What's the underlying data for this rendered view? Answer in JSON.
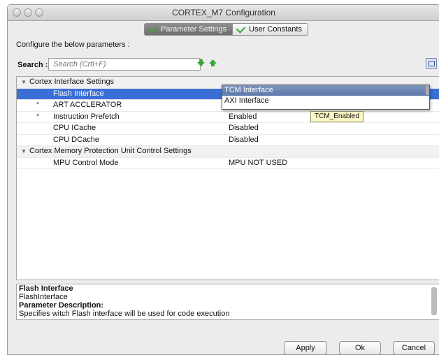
{
  "window": {
    "title": "CORTEX_M7 Configuration"
  },
  "tabs": [
    {
      "label": "Parameter Settings",
      "active": true
    },
    {
      "label": "User Constants",
      "active": false
    }
  ],
  "header": {
    "configure_text": "Configure the below parameters :"
  },
  "search": {
    "label": "Search :",
    "placeholder": "Search (Crtl+F)"
  },
  "tree": {
    "rows": [
      {
        "type": "group",
        "name": "Cortex Interface Settings",
        "value": ""
      },
      {
        "type": "param",
        "star": "",
        "name": "Flash Interface",
        "value": "",
        "selected": true
      },
      {
        "type": "param",
        "star": "*",
        "name": "ART ACCLERATOR",
        "value": ""
      },
      {
        "type": "param",
        "star": "*",
        "name": "Instruction Prefetch",
        "value": "Enabled"
      },
      {
        "type": "param",
        "star": "",
        "name": "CPU ICache",
        "value": "Disabled"
      },
      {
        "type": "param",
        "star": "",
        "name": "CPU DCache",
        "value": "Disabled"
      },
      {
        "type": "group",
        "name": "Cortex Memory Protection Unit Control Settings",
        "value": ""
      },
      {
        "type": "param",
        "star": "",
        "name": "MPU Control Mode",
        "value": "MPU NOT USED"
      }
    ]
  },
  "dropdown": {
    "options": [
      "TCM Interface",
      "AXI Interface"
    ],
    "highlighted": 0
  },
  "tooltip": {
    "text": "TCM_Enabled"
  },
  "description": {
    "title": "Flash Interface",
    "subtitle": "FlashInterface",
    "heading": "Parameter Description:",
    "text": "Specifies witch Flash interface will be used for code execution"
  },
  "buttons": {
    "apply": "Apply",
    "ok": "Ok",
    "cancel": "Cancel"
  },
  "colors": {
    "selection": "#3a6fd8",
    "tooltip_bg": "#fbf7c5",
    "arrow_green": "#3aa435"
  },
  "icons": [
    "expand-arrow-down-icon",
    "collapse-arrow-up-icon",
    "view-toggle-icon",
    "check-icon",
    "triangle-expanded-icon"
  ]
}
